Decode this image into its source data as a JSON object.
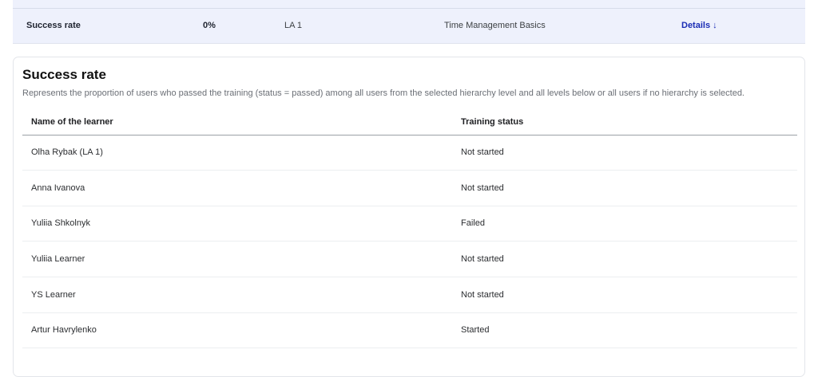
{
  "summary": {
    "metric": "Success rate",
    "value": "0%",
    "hierarchy": "LA 1",
    "course": "Time Management Basics",
    "details_label": "Details ↓"
  },
  "card": {
    "title": "Success rate",
    "description": "Represents the proportion of users who passed the training (status = passed) among all users from the selected hierarchy level and all levels below or all users if no hierarchy is selected.",
    "columns": [
      "Name of the learner",
      "Training status"
    ],
    "rows": [
      {
        "name": "Olha Rybak (LA 1)",
        "status": "Not started"
      },
      {
        "name": "Anna Ivanova",
        "status": "Not started"
      },
      {
        "name": "Yuliia Shkolnyk",
        "status": "Failed"
      },
      {
        "name": "Yuliia Learner",
        "status": "Not started"
      },
      {
        "name": "YS Learner",
        "status": "Not started"
      },
      {
        "name": "Artur Havrylenko",
        "status": "Started"
      }
    ]
  },
  "colors": {
    "summary_bg": "#eef1fc",
    "link": "#1a2db5"
  }
}
